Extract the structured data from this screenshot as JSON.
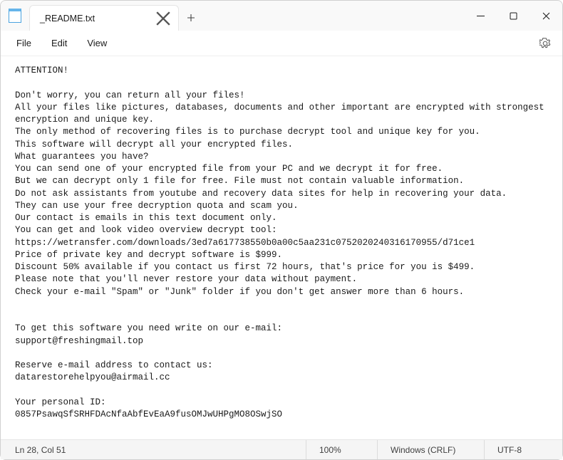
{
  "titlebar": {
    "tab_title": "_README.txt"
  },
  "menu": {
    "file": "File",
    "edit": "Edit",
    "view": "View"
  },
  "body": "ATTENTION!\n\nDon't worry, you can return all your files!\nAll your files like pictures, databases, documents and other important are encrypted with strongest encryption and unique key.\nThe only method of recovering files is to purchase decrypt tool and unique key for you.\nThis software will decrypt all your encrypted files.\nWhat guarantees you have?\nYou can send one of your encrypted file from your PC and we decrypt it for free.\nBut we can decrypt only 1 file for free. File must not contain valuable information.\nDo not ask assistants from youtube and recovery data sites for help in recovering your data.\nThey can use your free decryption quota and scam you.\nOur contact is emails in this text document only.\nYou can get and look video overview decrypt tool:\nhttps://wetransfer.com/downloads/3ed7a617738550b0a00c5aa231c0752020240316170955/d71ce1\nPrice of private key and decrypt software is $999.\nDiscount 50% available if you contact us first 72 hours, that's price for you is $499.\nPlease note that you'll never restore your data without payment.\nCheck your e-mail \"Spam\" or \"Junk\" folder if you don't get answer more than 6 hours.\n\n\nTo get this software you need write on our e-mail:\nsupport@freshingmail.top\n\nReserve e-mail address to contact us:\ndatarestorehelpyou@airmail.cc\n\nYour personal ID:\n0857PsawqSfSRHFDAcNfaAbfEvEaA9fusOMJwUHPgMO8OSwjSO",
  "status": {
    "position": "Ln 28, Col 51",
    "zoom": "100%",
    "lineending": "Windows (CRLF)",
    "encoding": "UTF-8"
  }
}
